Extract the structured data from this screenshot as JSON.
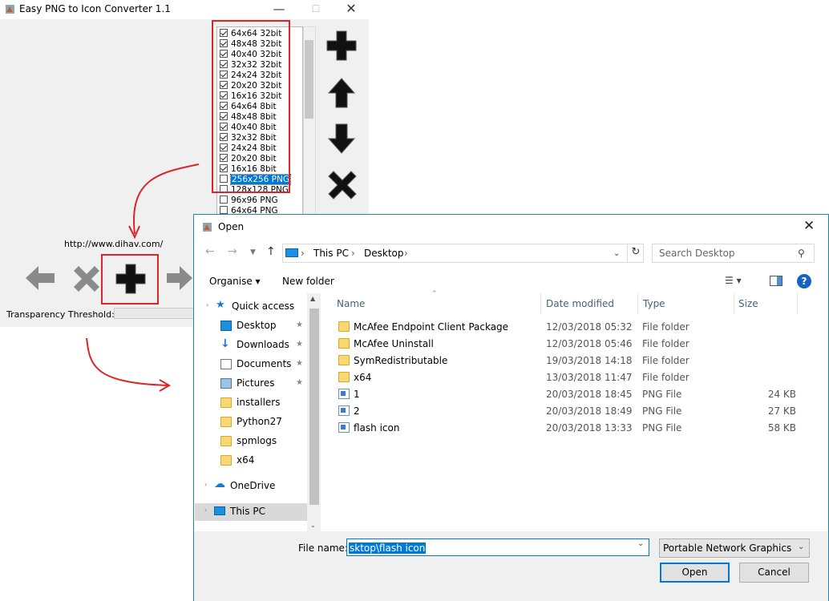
{
  "converter": {
    "title": "Easy PNG to Icon Converter 1.1",
    "url": "http://www.dihav.com/",
    "threshold_label": "Transparency Threshold:",
    "sizes": [
      {
        "label": "64x64 32bit",
        "checked": true
      },
      {
        "label": "48x48 32bit",
        "checked": true
      },
      {
        "label": "40x40 32bit",
        "checked": true
      },
      {
        "label": "32x32 32bit",
        "checked": true
      },
      {
        "label": "24x24 32bit",
        "checked": true
      },
      {
        "label": "20x20 32bit",
        "checked": true
      },
      {
        "label": "16x16 32bit",
        "checked": true
      },
      {
        "label": "64x64 8bit",
        "checked": true
      },
      {
        "label": "48x48 8bit",
        "checked": true
      },
      {
        "label": "40x40 8bit",
        "checked": true
      },
      {
        "label": "32x32 8bit",
        "checked": true
      },
      {
        "label": "24x24 8bit",
        "checked": true
      },
      {
        "label": "20x20 8bit",
        "checked": true
      },
      {
        "label": "16x16 8bit",
        "checked": true
      },
      {
        "label": "256x256 PNG",
        "checked": false,
        "selected": true
      },
      {
        "label": "128x128 PNG",
        "checked": false
      },
      {
        "label": "96x96 PNG",
        "checked": false
      },
      {
        "label": "64x64 PNG",
        "checked": false
      }
    ]
  },
  "dialog": {
    "title": "Open",
    "breadcrumb": [
      "This PC",
      "Desktop"
    ],
    "search_placeholder": "Search Desktop",
    "toolbar": {
      "organise": "Organise ▾",
      "new_folder": "New folder"
    },
    "nav": [
      {
        "label": "Quick access",
        "icon": "star-icon"
      },
      {
        "label": "Desktop",
        "icon": "desktop-icon",
        "pinned": true
      },
      {
        "label": "Downloads",
        "icon": "download-icon",
        "pinned": true
      },
      {
        "label": "Documents",
        "icon": "documents-icon",
        "pinned": true
      },
      {
        "label": "Pictures",
        "icon": "pictures-icon",
        "pinned": true
      },
      {
        "label": "installers",
        "icon": "folder-icon"
      },
      {
        "label": "Python27",
        "icon": "folder-icon"
      },
      {
        "label": "spmlogs",
        "icon": "folder-icon"
      },
      {
        "label": "x64",
        "icon": "folder-icon"
      },
      {
        "label": "OneDrive",
        "icon": "cloud-icon"
      },
      {
        "label": "This PC",
        "icon": "computer-icon",
        "selected": true
      }
    ],
    "columns": {
      "name": "Name",
      "date": "Date modified",
      "type": "Type",
      "size": "Size"
    },
    "files": [
      {
        "name": "McAfee Endpoint Client Package",
        "date": "12/03/2018 05:32",
        "type": "File folder",
        "size": "",
        "kind": "folder"
      },
      {
        "name": "McAfee Uninstall",
        "date": "12/03/2018 05:46",
        "type": "File folder",
        "size": "",
        "kind": "folder"
      },
      {
        "name": "SymRedistributable",
        "date": "19/03/2018 14:18",
        "type": "File folder",
        "size": "",
        "kind": "folder"
      },
      {
        "name": "x64",
        "date": "13/03/2018 11:47",
        "type": "File folder",
        "size": "",
        "kind": "folder"
      },
      {
        "name": "1",
        "date": "20/03/2018 18:45",
        "type": "PNG File",
        "size": "24 KB",
        "kind": "png"
      },
      {
        "name": "2",
        "date": "20/03/2018 18:49",
        "type": "PNG File",
        "size": "27 KB",
        "kind": "png"
      },
      {
        "name": "flash icon",
        "date": "20/03/2018 13:33",
        "type": "PNG File",
        "size": "58 KB",
        "kind": "png"
      }
    ],
    "file_name_label": "File name:",
    "file_name_value": "sktop\\flash icon",
    "file_type": "Portable Network Graphics (*.p",
    "open_label": "Open",
    "cancel_label": "Cancel"
  },
  "colors": {
    "annotation_red": "#d9262b",
    "accent": "#0078d7"
  }
}
